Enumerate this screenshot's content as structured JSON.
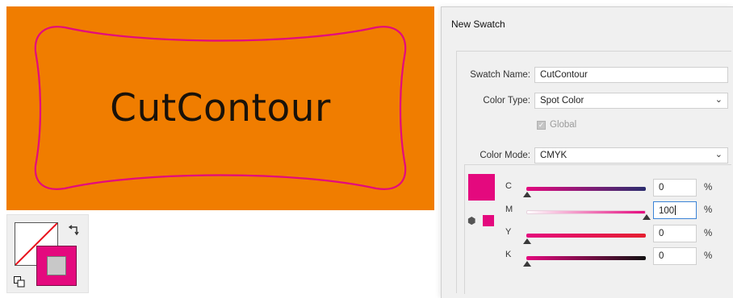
{
  "artboard": {
    "text": "CutContour",
    "background": "#f07d00",
    "contour_color": "#e4097e"
  },
  "fill_stroke": {
    "fill": "none",
    "stroke_color": "#e4097e",
    "icons": [
      "none-fill-icon",
      "swap-arrow-icon",
      "default-colors-icon"
    ]
  },
  "dialog": {
    "title": "New Swatch",
    "swatch_name_label": "Swatch Name:",
    "swatch_name_value": "CutContour",
    "color_type_label": "Color Type:",
    "color_type_value": "Spot Color",
    "global_label": "Global",
    "global_checked": true,
    "color_mode_label": "Color Mode:",
    "color_mode_value": "CMYK",
    "swatch_color": "#e4097e",
    "percent_sign": "%",
    "channels": [
      {
        "label": "C",
        "value": "0"
      },
      {
        "label": "M",
        "value": "100"
      },
      {
        "label": "Y",
        "value": "0"
      },
      {
        "label": "K",
        "value": "0"
      }
    ]
  }
}
